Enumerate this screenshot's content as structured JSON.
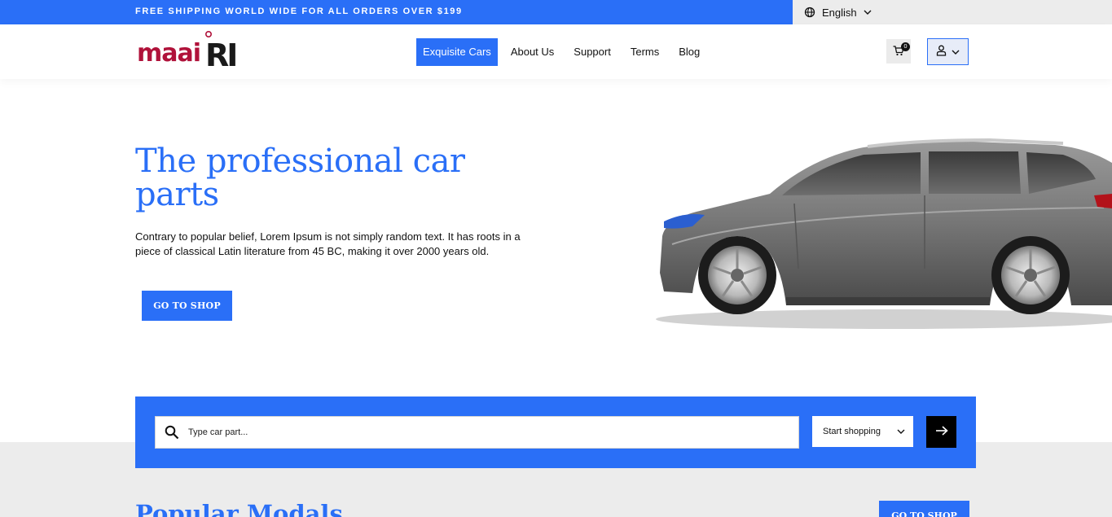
{
  "topbar": {
    "promo": "FREE SHIPPING WORLD WIDE FOR ALL ORDERS OVER $199",
    "language": "English"
  },
  "header": {
    "logo_text": "maaiRI",
    "nav": [
      {
        "label": "Exquisite Cars",
        "active": true
      },
      {
        "label": "About Us",
        "active": false
      },
      {
        "label": "Support",
        "active": false
      },
      {
        "label": "Terms",
        "active": false
      },
      {
        "label": "Blog",
        "active": false
      }
    ],
    "cart_count": "0"
  },
  "hero": {
    "title": "The professional car parts",
    "text": "Contrary to popular belief, Lorem Ipsum is not simply random text. It has roots in a piece of classical Latin literature from 45 BC, making it over 2000 years old.",
    "button": "GO TO SHOP"
  },
  "search": {
    "placeholder": "Type car part...",
    "select_value": "Start shopping"
  },
  "popular": {
    "title": "Popular Modals",
    "button": "GO TO SHOP"
  },
  "colors": {
    "accent": "#2a6ff7",
    "logo_red": "#b0123a",
    "logo_dark": "#1a1a1a"
  }
}
